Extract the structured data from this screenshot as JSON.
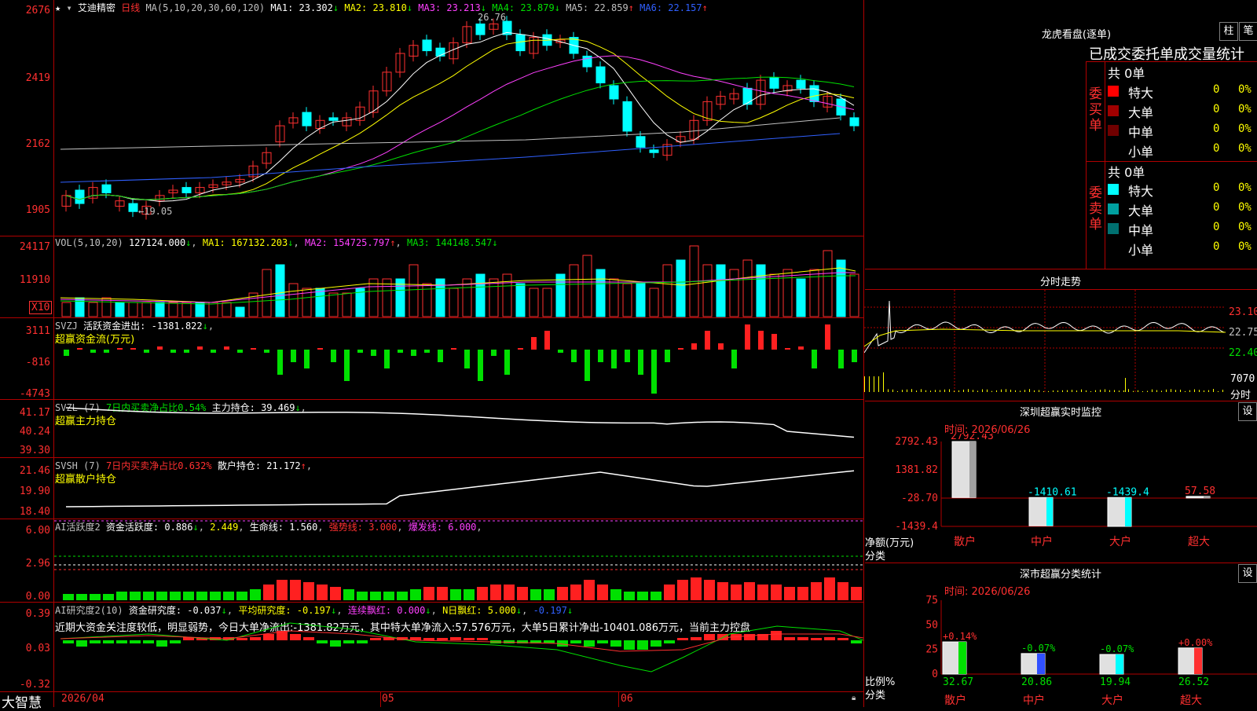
{
  "stock": {
    "name": "艾迪精密",
    "period": "日线"
  },
  "main_chart": {
    "ma_params": "MA(5,10,20,30,60,120)",
    "ma": [
      {
        "label": "MA1: 23.302",
        "arrow": "↓",
        "color": "#ffffff"
      },
      {
        "label": "MA2: 23.810",
        "arrow": "↓",
        "color": "#ffff00"
      },
      {
        "label": "MA3: 23.213",
        "arrow": "↓",
        "color": "#ff40ff"
      },
      {
        "label": "MA4: 23.879",
        "arrow": "↓",
        "color": "#00e000"
      },
      {
        "label": "MA5: 22.859",
        "arrow": "↑",
        "color": "#c0c0c0"
      },
      {
        "label": "MA6: 22.157",
        "arrow": "↑",
        "color": "#3060ff"
      }
    ],
    "y_labels": [
      "2676",
      "2419",
      "2162",
      "1905"
    ],
    "high_label": "26.76",
    "low_label": "←19.05"
  },
  "vol": {
    "header": "VOL(5,10,20)",
    "value": "127124.000",
    "value_arrow": "↓",
    "ma1": "MA1: 167132.203",
    "ma1_arrow": "↓",
    "ma2": "MA2: 154725.797",
    "ma2_arrow": "↑",
    "ma3": "MA3: 144148.547",
    "ma3_arrow": "↓",
    "y_labels": [
      "24117",
      "11910"
    ],
    "unit": "X10"
  },
  "svzj": {
    "header": "SVZJ",
    "label": "活跃资金进出: -1381.822",
    "arrow": "↓",
    "sub": "超赢资金流(万元)",
    "y_labels": [
      "3111",
      "-816",
      "-4743"
    ]
  },
  "svzl": {
    "header": "SVZL (7)",
    "label1": "7日内买卖净占比0.54%",
    "label2": "主力持仓: 39.469",
    "arrow": "↓",
    "sub": "超赢主力持仓",
    "y_labels": [
      "41.17",
      "40.24",
      "39.30"
    ]
  },
  "svsh": {
    "header": "SVSH (7)",
    "label1": "7日内买卖净占比0.632%",
    "label2": "散户持仓: 21.172",
    "arrow": "↑",
    "sub": "超赢散户持仓",
    "y_labels": [
      "21.46",
      "19.90",
      "18.40"
    ]
  },
  "ai_act": {
    "header": "AI活跃度2",
    "label": "资金活跃度: 0.886",
    "arrow": "↓",
    "v2": "2.449",
    "life": "生命线: 1.560",
    "strong": "强势线: 3.000",
    "burst": "爆发线: 6.000",
    "y_labels": [
      "6.00",
      "2.96",
      "0.00"
    ]
  },
  "ai_res": {
    "header": "AI研究度2(10)",
    "label": "资金研究度: -0.037",
    "avg": "平均研究度: -0.197",
    "lianxu": "连续飘红: 0.000",
    "nri": "N日飘红: 5.000",
    "neg": "-0.197",
    "commentary": "近期大资金关注度较低，明显弱势，今日大单净流出:-1381.82万元，其中特大单净流入:57.576万元，大单5日累计净出-10401.086万元，当前主力控盘",
    "y_labels": [
      "0.39",
      "0.03",
      "-0.32"
    ]
  },
  "x_axis": {
    "labels": [
      "2026/04",
      "05",
      "06"
    ]
  },
  "footer": {
    "brand": "大智慧"
  },
  "longhu": {
    "title": "龙虎看盘(逐单)",
    "btn1": "柱",
    "btn2": "笔",
    "tabs": "已成交委托单成交量统计",
    "buy_side": "委买单",
    "sell_side": "委卖单",
    "buy_total": "共 0单",
    "sell_total": "共 0单",
    "buy_rows": [
      {
        "name": "特大",
        "count": "0",
        "pct": "0%",
        "color": "#ff0000"
      },
      {
        "name": "大单",
        "count": "0",
        "pct": "0%",
        "color": "#a00000"
      },
      {
        "name": "中单",
        "count": "0",
        "pct": "0%",
        "color": "#700000"
      },
      {
        "name": "小单",
        "count": "0",
        "pct": "0%",
        "color": "#000000"
      }
    ],
    "sell_rows": [
      {
        "name": "特大",
        "count": "0",
        "pct": "0%",
        "color": "#00ffff"
      },
      {
        "name": "大单",
        "count": "0",
        "pct": "0%",
        "color": "#00a0a0"
      },
      {
        "name": "中单",
        "count": "0",
        "pct": "0%",
        "color": "#007070"
      },
      {
        "name": "小单",
        "count": "0",
        "pct": "0%",
        "color": "#000000"
      }
    ]
  },
  "intraday": {
    "title": "分时走势",
    "y_labels": [
      "23.10",
      "22.75",
      "22.40"
    ],
    "vol_label": "7070",
    "vol_unit": "分时"
  },
  "monitor": {
    "title": "深圳超赢实时监控",
    "set": "设",
    "time": "时间: 2026/06/26",
    "y_labels": [
      "2792.43",
      "1381.82",
      "-28.70",
      "-1439.4"
    ],
    "axis_label1": "净额(万元)",
    "axis_label2": "分类",
    "bars": [
      {
        "cat": "散户",
        "value": 2792.43,
        "label": "2792.43"
      },
      {
        "cat": "中户",
        "value": -1410.61,
        "label": "-1410.61"
      },
      {
        "cat": "大户",
        "value": -1439.4,
        "label": "-1439.4"
      },
      {
        "cat": "超大",
        "value": 57.58,
        "label": "57.58"
      }
    ]
  },
  "classify": {
    "title": "深市超赢分类统计",
    "set": "设",
    "time": "时间: 2026/06/26",
    "y_labels": [
      "75",
      "50",
      "25",
      "0"
    ],
    "axis_label1": "比例%",
    "axis_label2": "分类",
    "bars": [
      {
        "cat": "散户",
        "value": 32.67,
        "label": "32.67",
        "change": "+0.14%"
      },
      {
        "cat": "中户",
        "value": 20.86,
        "label": "20.86",
        "change": "-0.07%"
      },
      {
        "cat": "大户",
        "value": 19.94,
        "label": "19.94",
        "change": "-0.07%"
      },
      {
        "cat": "超大",
        "value": 26.52,
        "label": "26.52",
        "change": "+0.00%"
      }
    ]
  },
  "colors": {
    "up": "#ff3030",
    "down": "#00ffff",
    "grid": "#b00000"
  }
}
